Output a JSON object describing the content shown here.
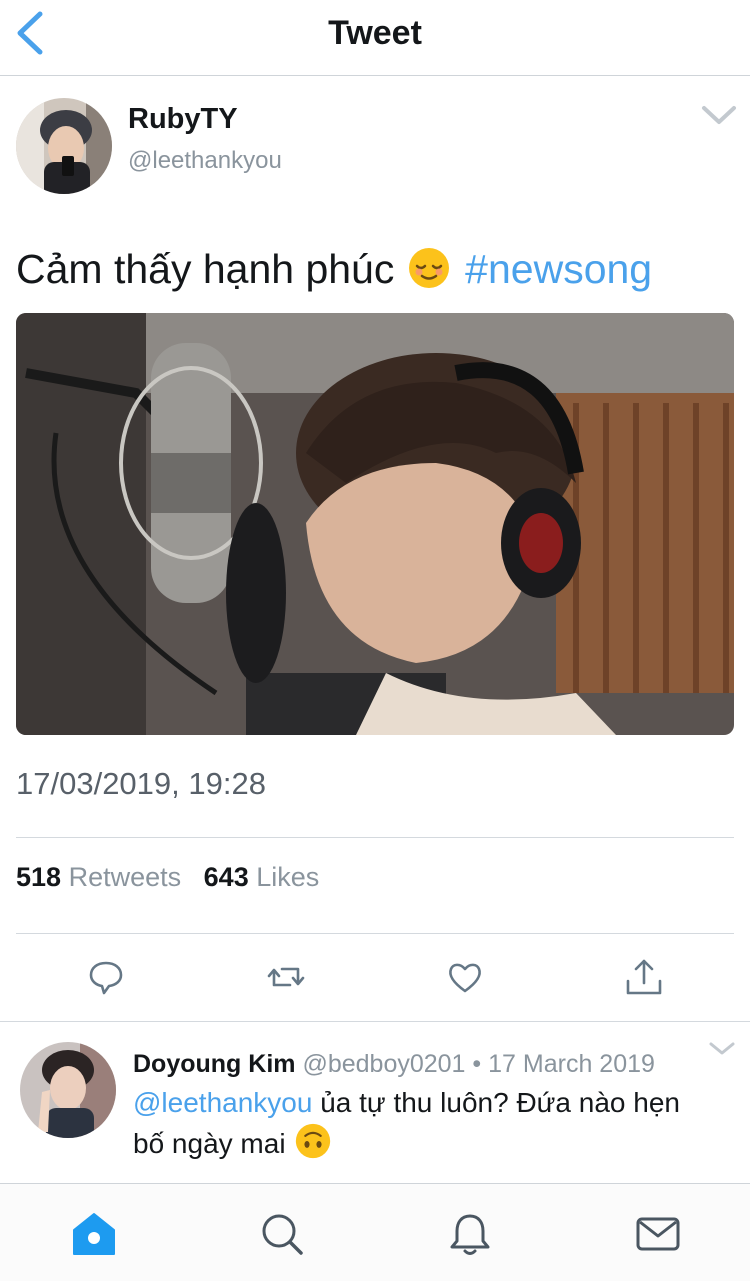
{
  "header": {
    "title": "Tweet"
  },
  "tweet": {
    "display_name": "RubyTY",
    "handle": "@leethankyou",
    "text": "Cảm thấy hạnh phúc",
    "hashtag": "#newsong",
    "timestamp": "17/03/2019, 19:28",
    "retweets_count": "518",
    "retweets_label": "Retweets",
    "likes_count": "643",
    "likes_label": "Likes"
  },
  "reply": {
    "display_name": "Doyoung Kim",
    "handle": "@bedboy0201",
    "separator": "•",
    "date": "17 March 2019",
    "mention": "@leethankyou",
    "text_line1": "ủa tự thu luôn? Đứa nào hẹn",
    "text_line2": "bố ngày mai"
  },
  "icons": {
    "back": "chevron-left-icon",
    "more": "chevron-down-icon",
    "reply": "reply-icon",
    "retweet": "retweet-icon",
    "like": "heart-icon",
    "share": "share-icon",
    "home": "home-icon",
    "search": "search-icon",
    "notifications": "bell-icon",
    "messages": "mail-icon"
  },
  "colors": {
    "accent": "#4aa1eb",
    "muted": "#8a949d",
    "text": "#14171a",
    "tab_active": "#1d9bf0"
  }
}
